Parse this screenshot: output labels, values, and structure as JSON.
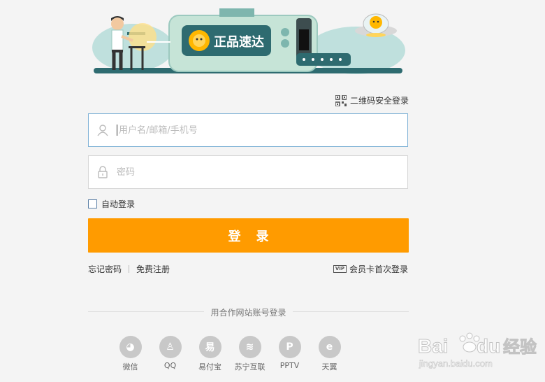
{
  "banner": {
    "slogan": "正品速达",
    "colors": {
      "teal": "#2e6b70",
      "mint": "#c6e4d7",
      "cloud": "#bfe0dd",
      "brand": "#ffb700"
    }
  },
  "qr_login": {
    "label": "二维码安全登录",
    "icon": "qr-code-icon"
  },
  "username": {
    "placeholder": "用户名/邮箱/手机号",
    "value": "",
    "icon": "user-icon"
  },
  "password": {
    "placeholder": "密码",
    "value": "",
    "icon": "lock-icon"
  },
  "auto_login": {
    "label": "自动登录",
    "checked": false
  },
  "login_button": {
    "label": "登录",
    "color": "#ff9b00"
  },
  "links": {
    "forgot": "忘记密码",
    "register": "免费注册",
    "vip_badge": "VIP",
    "vip_login": "会员卡首次登录"
  },
  "partner_section": {
    "title": "用合作网站账号登录",
    "items": [
      {
        "label": "微信",
        "icon": "wechat-icon",
        "glyph": "◕"
      },
      {
        "label": "QQ",
        "icon": "qq-icon",
        "glyph": "♙"
      },
      {
        "label": "易付宝",
        "icon": "yifubao-icon",
        "glyph": "易"
      },
      {
        "label": "苏宁互联",
        "icon": "suning-wifi-icon",
        "glyph": "≋"
      },
      {
        "label": "PPTV",
        "icon": "pptv-icon",
        "glyph": "P"
      },
      {
        "label": "天翼",
        "icon": "tianyi-icon",
        "glyph": "e"
      }
    ]
  },
  "watermark": {
    "brand": "Bai",
    "brand2": "du",
    "cn": "经验",
    "url": "jingyan.baidu.com"
  }
}
